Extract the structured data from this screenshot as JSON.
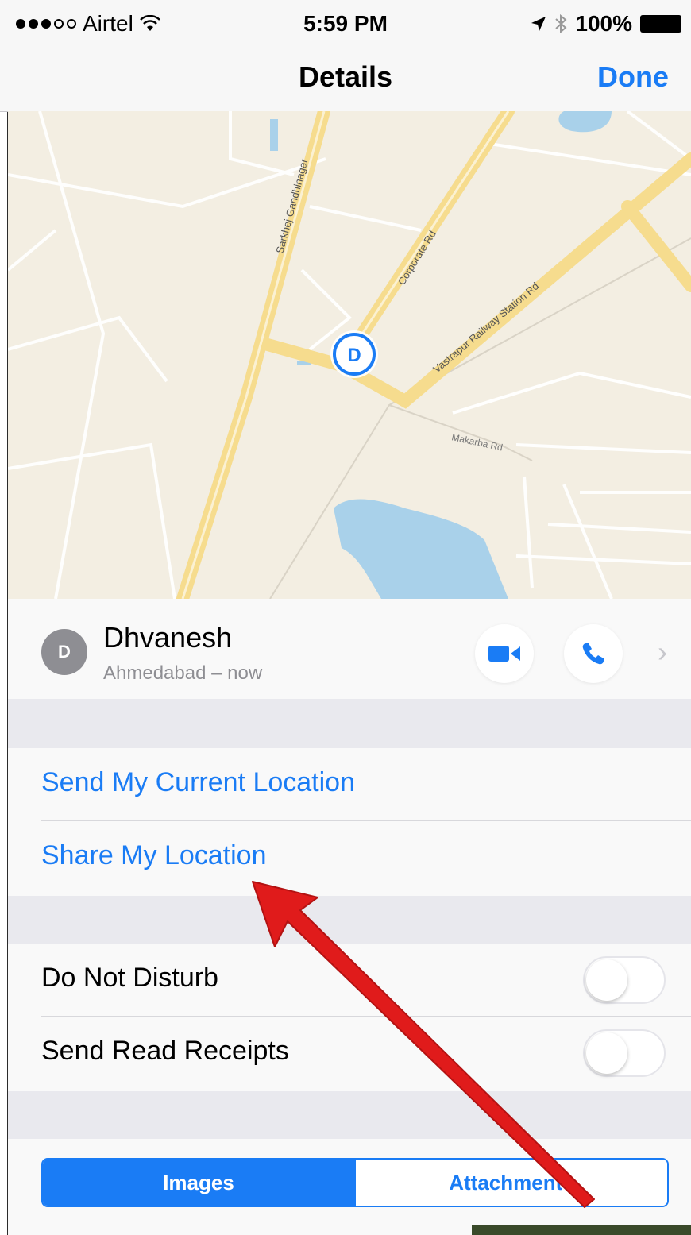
{
  "status_bar": {
    "carrier": "Airtel",
    "time": "5:59 PM",
    "battery": "100%"
  },
  "nav": {
    "title": "Details",
    "done_label": "Done"
  },
  "map": {
    "street_labels": [
      "Sarkhej Gandhinagar",
      "Corporate Rd",
      "Vastrapur Railway Station Rd",
      "Makarba Rd"
    ],
    "pin_letter": "D"
  },
  "contact": {
    "avatar_initial": "D",
    "name": "Dhvanesh",
    "subtitle": "Ahmedabad – now"
  },
  "location_section": {
    "items": [
      {
        "label": "Send My Current Location"
      },
      {
        "label": "Share My Location"
      }
    ]
  },
  "settings_section": {
    "items": [
      {
        "label": "Do Not Disturb",
        "on": false
      },
      {
        "label": "Send Read Receipts",
        "on": false
      }
    ]
  },
  "segment": {
    "tabs": [
      {
        "label": "Images",
        "active": true
      },
      {
        "label": "Attachments",
        "active": false
      }
    ]
  },
  "colors": {
    "accent": "#1a7cf5",
    "annotation_arrow": "#e01b1b"
  },
  "icons": {
    "video": "video-camera-icon",
    "phone": "phone-icon",
    "chevron": "chevron-right-icon",
    "wifi": "wifi-icon",
    "location": "location-arrow-icon",
    "bluetooth": "bluetooth-icon"
  }
}
